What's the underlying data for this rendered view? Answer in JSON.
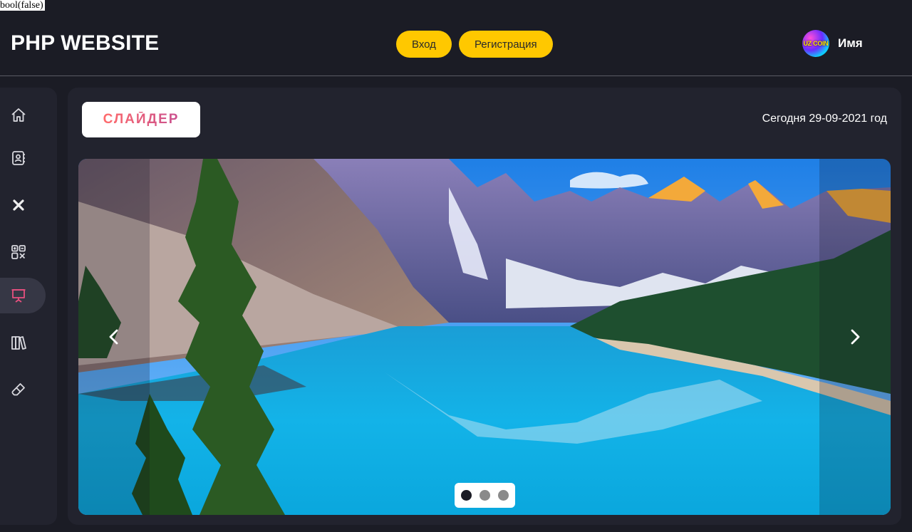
{
  "debug_text": "bool(false)",
  "header": {
    "logo": "PHP WEBSITE",
    "login_label": "Вход",
    "register_label": "Регистрация",
    "username": "Имя",
    "avatar_text": "UZ COIN"
  },
  "sidebar": {
    "items": [
      {
        "icon": "home-icon",
        "active": false
      },
      {
        "icon": "contacts-icon",
        "active": false
      },
      {
        "icon": "close-icon",
        "active": false
      },
      {
        "icon": "grid-icon",
        "active": false
      },
      {
        "icon": "presentation-icon",
        "active": true
      },
      {
        "icon": "library-icon",
        "active": false
      },
      {
        "icon": "eraser-icon",
        "active": false
      }
    ],
    "active_color": "#e8507f"
  },
  "main": {
    "title": "СЛАЙДЕР",
    "date_text": "Сегодня 29-09-2021 год"
  },
  "slider": {
    "image": "mountain-lake-landscape",
    "slide_count": 3,
    "active_slide": 1
  },
  "colors": {
    "background": "#1b1c25",
    "panel": "#22232e",
    "accent_yellow": "#ffc800"
  }
}
